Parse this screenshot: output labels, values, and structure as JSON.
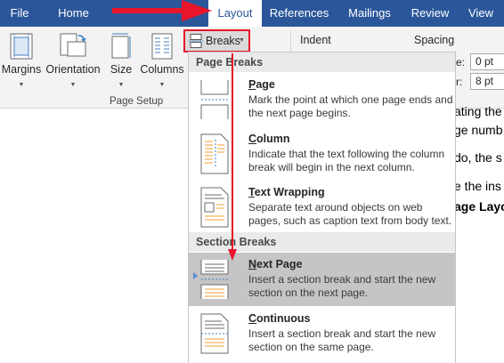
{
  "tabs": [
    {
      "label": "File",
      "active": false
    },
    {
      "label": "Home",
      "active": false
    },
    {
      "label": "Layout",
      "active": true
    },
    {
      "label": "References",
      "active": false
    },
    {
      "label": "Mailings",
      "active": false
    },
    {
      "label": "Review",
      "active": false
    },
    {
      "label": "View",
      "active": false
    }
  ],
  "ribbon": {
    "page_setup": {
      "margins": "Margins",
      "orientation": "Orientation",
      "size": "Size",
      "columns": "Columns",
      "group_label": "Page Setup"
    },
    "breaks": "Breaks",
    "indent": "Indent",
    "spacing": {
      "label": "Spacing",
      "before_label": "e:",
      "before_value": "0 pt",
      "after_label": "r:",
      "after_value": "8 pt"
    }
  },
  "menu": {
    "page_breaks_header": "Page Breaks",
    "section_breaks_header": "Section Breaks",
    "items": [
      {
        "key": "P",
        "rest": "age",
        "desc": "Mark the point at which one page ends and the next page begins.",
        "highlighted": false
      },
      {
        "key": "C",
        "rest": "olumn",
        "desc": "Indicate that the text following the column break will begin in the next column.",
        "highlighted": false
      },
      {
        "key": "T",
        "rest": "ext Wrapping",
        "desc": "Separate text around objects on web pages, such as caption text from body text.",
        "highlighted": false
      },
      {
        "key": "N",
        "rest": "ext Page",
        "desc": "Insert a section break and start the new section on the next page.",
        "highlighted": true
      },
      {
        "key": "C",
        "rest": "ontinuous",
        "desc": "Insert a section break and start the new section on the same page.",
        "highlighted": false
      }
    ]
  },
  "document": {
    "lines": [
      "ating the",
      "ge numb",
      "do, the s",
      "e the ins",
      "age Layo"
    ]
  },
  "colors": {
    "tab_bar": "#2b579a",
    "annotation_red": "#e8152b",
    "highlight": "#c5c5c5"
  },
  "icons": [
    "margins-icon",
    "orientation-icon",
    "size-icon",
    "columns-icon",
    "breaks-icon",
    "page-break-icon",
    "column-break-icon",
    "text-wrapping-icon",
    "next-page-icon",
    "continuous-icon"
  ]
}
